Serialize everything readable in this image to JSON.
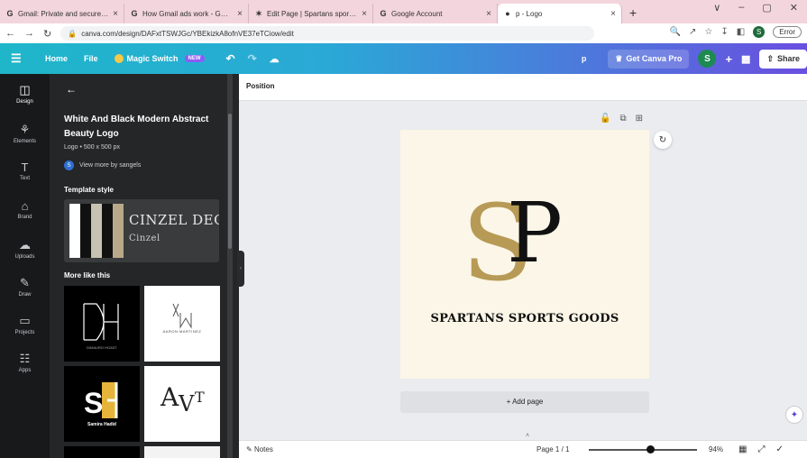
{
  "browser": {
    "tabs": [
      {
        "favicon": "G",
        "title": "Gmail: Private and secure email",
        "active": false
      },
      {
        "favicon": "G",
        "title": "How Gmail ads work - Gmail He",
        "active": false
      },
      {
        "favicon": "✶",
        "title": "Edit Page | Spartans sports gooc",
        "active": false
      },
      {
        "favicon": "G",
        "title": "Google Account",
        "active": false
      },
      {
        "favicon": "●",
        "title": "p - Logo",
        "active": true
      }
    ],
    "new_tab": "+",
    "window_controls": [
      "∨",
      "–",
      "▢",
      "✕"
    ],
    "url": "canva.com/design/DAFxtTSWJGc/YBEkizkA8ofnVE37eTCiow/edit",
    "profile_initial": "S",
    "error_label": "Error"
  },
  "header": {
    "menu_icon": "☰",
    "home": "Home",
    "file": "File",
    "magic_switch": "Magic Switch",
    "new_badge": "NEW",
    "design_name": "p",
    "get_pro": "Get Canva Pro",
    "avatar_initial": "S",
    "plus": "+",
    "share": "Share"
  },
  "rail": [
    {
      "name": "design",
      "label": "Design",
      "icon": "◫",
      "active": true
    },
    {
      "name": "elements",
      "label": "Elements",
      "icon": "⚘",
      "active": false
    },
    {
      "name": "text",
      "label": "Text",
      "icon": "T",
      "active": false
    },
    {
      "name": "brand",
      "label": "Brand",
      "icon": "⌂",
      "active": false
    },
    {
      "name": "uploads",
      "label": "Uploads",
      "icon": "☁",
      "active": false
    },
    {
      "name": "draw",
      "label": "Draw",
      "icon": "✎",
      "active": false
    },
    {
      "name": "projects",
      "label": "Projects",
      "icon": "▭",
      "active": false
    },
    {
      "name": "apps",
      "label": "Apps",
      "icon": "☷",
      "active": false
    }
  ],
  "panel": {
    "back": "←",
    "template_title": "White And Black Modern Abstract Beauty Logo",
    "template_meta": "Logo • 500 x 500 px",
    "author_initial": "S",
    "author_link": "View more by sangels",
    "template_style_heading": "Template style",
    "style_font_primary": "CINZEL DEC",
    "style_font_secondary": "Cinzel",
    "swatch_colors": [
      "#ffffff",
      "#111111",
      "#c8c2b2",
      "#111111",
      "#b9a98a"
    ],
    "more_heading": "More like this",
    "thumbs": [
      {
        "name": "dh-logo",
        "text": "DH",
        "sub": "DIMAURO HOAST"
      },
      {
        "name": "am-logo",
        "text": "AM",
        "sub": "AARON MARTINEZ"
      },
      {
        "name": "sh-logo",
        "text": "SH",
        "sub": "Samira Hadid"
      },
      {
        "name": "av-logo",
        "text": "AVT",
        "sub": ""
      }
    ]
  },
  "toolbar": {
    "position_label": "Position"
  },
  "canvas": {
    "brand_text": "SPARTANS SPORTS GOODS",
    "logo_letters": "SP",
    "bg_color": "#fbf6e7",
    "gold": "#b79a55",
    "add_page": "+ Add page"
  },
  "footer": {
    "notes": "Notes",
    "page": "Page 1 / 1",
    "zoom": "94%",
    "zoom_fraction": 0.53
  }
}
